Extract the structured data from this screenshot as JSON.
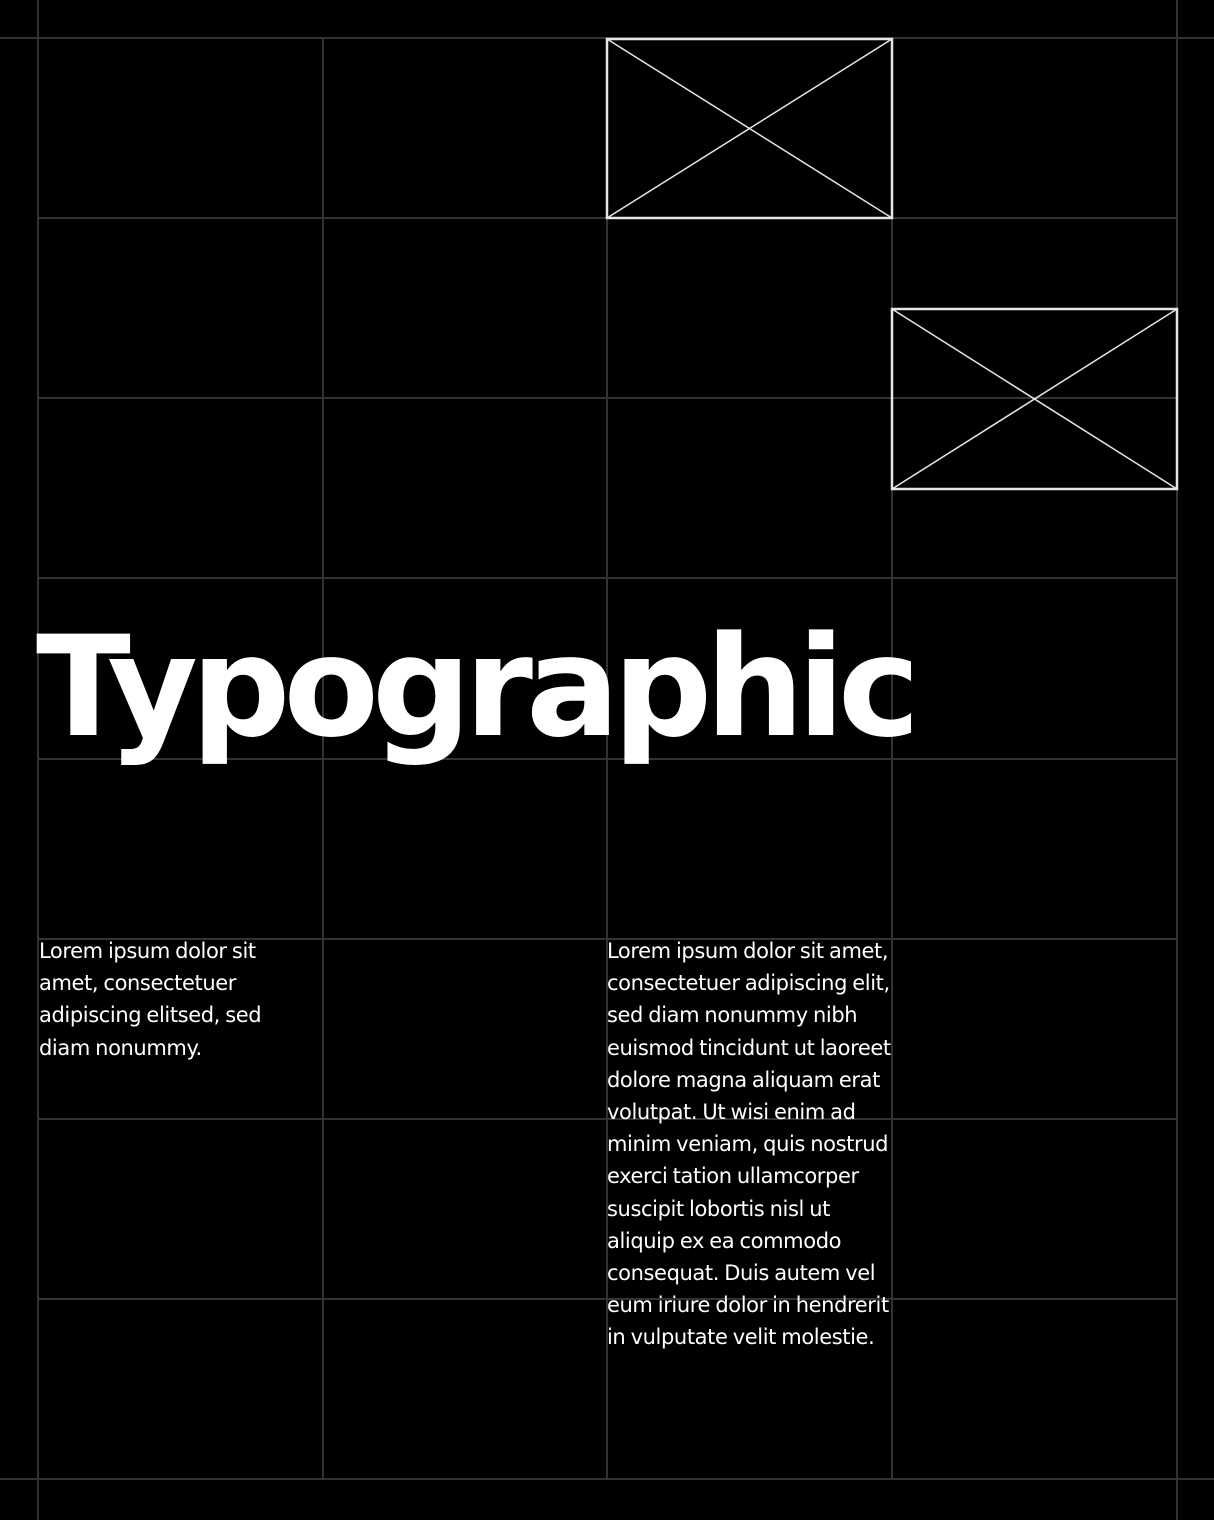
{
  "headline": "Typographic",
  "body_left": "Lorem ipsum dolor sit amet, consectetuer adipiscing elitsed, sed diam nonummy.",
  "body_right": "Lorem ipsum dolor sit amet, consectetuer adipiscing elit, sed diam nonummy nibh euismod tincidunt ut laoreet dolore magna aliquam erat volutpat. Ut wisi enim ad minim veniam, quis nostrud exerci tation ullamcorper suscipit lobortis nisl ut aliquip ex ea commodo consequat. Duis autem vel eum iriure dolor in hendrerit in vulputate velit molestie.",
  "colors": {
    "background": "#000000",
    "grid": "#333333",
    "text": "#ffffff",
    "placeholder_stroke": "#e6e6e6"
  },
  "icons": {
    "image_placeholder": "image-placeholder-icon"
  }
}
